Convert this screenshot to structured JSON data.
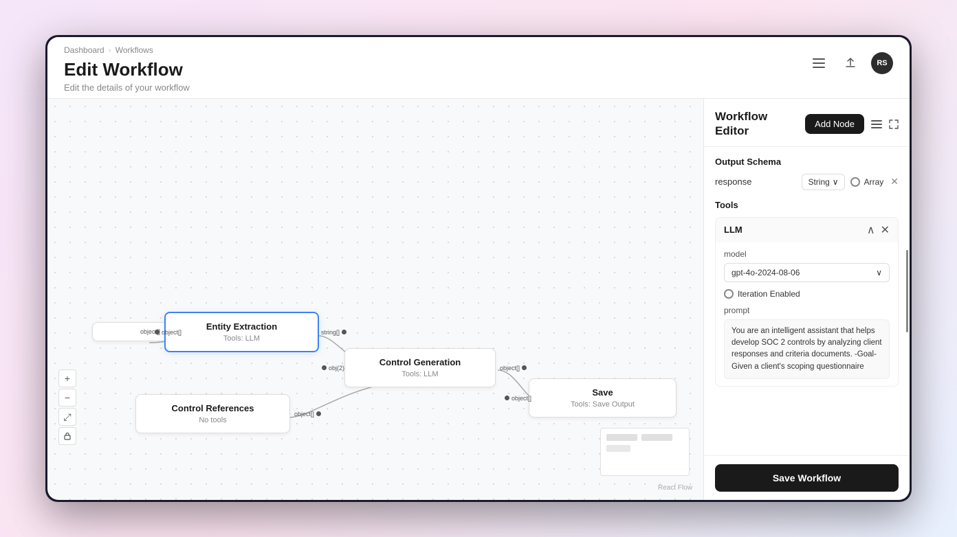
{
  "breadcrumb": {
    "home": "Dashboard",
    "separator": "›",
    "current": "Workflows"
  },
  "header": {
    "title": "Edit Workflow",
    "subtitle": "Edit the details of your workflow",
    "icons": {
      "menu": "≡",
      "export": "⬡",
      "avatar": "RS"
    }
  },
  "canvas": {
    "react_flow_label": "React Flow",
    "zoom_in": "+",
    "zoom_out": "−",
    "fit": "⤢",
    "lock": "🔒"
  },
  "nodes": [
    {
      "id": "entity-extraction",
      "title": "Entity Extraction",
      "subtitle": "Tools: LLM",
      "left_port": "object[]",
      "right_port": "string[]",
      "selected": true
    },
    {
      "id": "control-references",
      "title": "Control References",
      "subtitle": "No tools",
      "right_port": "object[]"
    },
    {
      "id": "control-generation",
      "title": "Control Generation",
      "subtitle": "Tools: LLM",
      "left_port": "obj(2)",
      "right_port": "object[]"
    },
    {
      "id": "save",
      "title": "Save",
      "subtitle": "Tools: Save Output",
      "left_port": "object[]"
    }
  ],
  "panel": {
    "title": "Workflow\nEditor",
    "add_node_label": "Add Node",
    "output_schema_label": "Output Schema",
    "schema_key": "response",
    "schema_type": "String",
    "schema_chevron": "∨",
    "schema_radio": "○",
    "schema_array": "Array",
    "schema_close": "✕",
    "tools_label": "Tools",
    "llm_label": "LLM",
    "llm_collapse": "∧",
    "llm_close": "✕",
    "model_label": "model",
    "model_value": "gpt-4o-2024-08-06",
    "model_chevron": "∨",
    "iteration_label": "Iteration Enabled",
    "prompt_label": "prompt",
    "prompt_text": "You are an intelligent assistant that helps develop SOC 2 controls by analyzing client responses and criteria documents.\n\n-Goal-\nGiven a client's scoping questionnaire",
    "save_workflow_label": "Save Workflow"
  }
}
